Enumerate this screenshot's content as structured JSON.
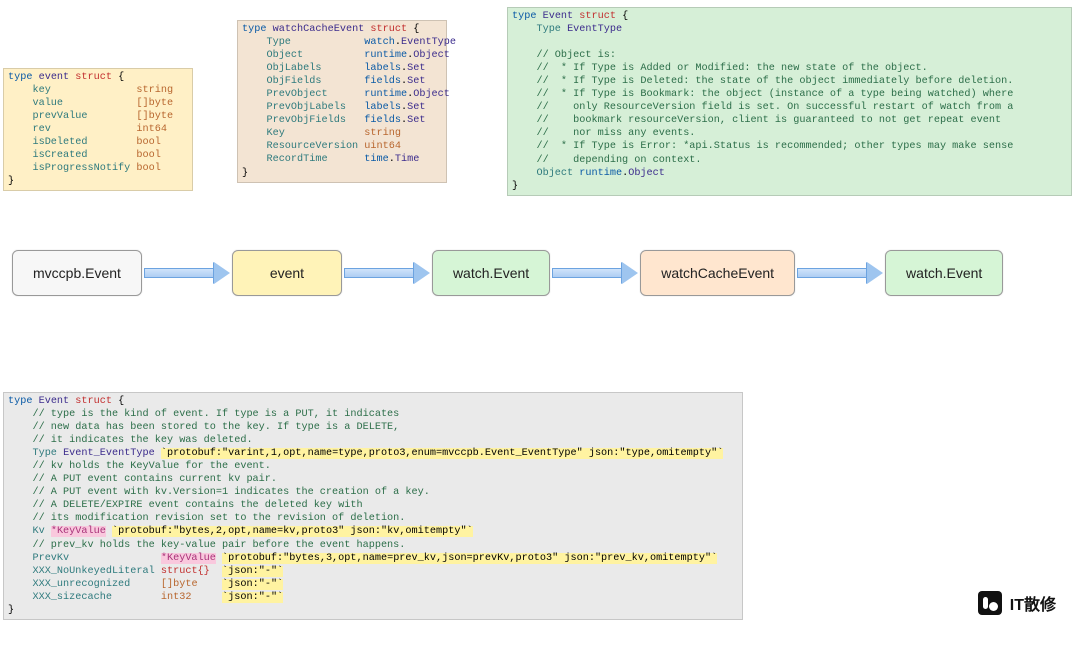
{
  "flow": {
    "nodes": [
      {
        "label": "mvccpb.Event",
        "cls": "node-white"
      },
      {
        "label": "event",
        "cls": "node-yellow"
      },
      {
        "label": "watch.Event",
        "cls": "node-green"
      },
      {
        "label": "watchCacheEvent",
        "cls": "node-peach"
      },
      {
        "label": "watch.Event",
        "cls": "node-green"
      }
    ]
  },
  "watermark": "IT散修",
  "event_struct": {
    "decl_type": "type",
    "name": "event",
    "kw_struct": "struct",
    "brace_open": "{",
    "brace_close": "}",
    "fields": [
      {
        "name": "key",
        "type": "string"
      },
      {
        "name": "value",
        "type": "[]byte"
      },
      {
        "name": "prevValue",
        "type": "[]byte"
      },
      {
        "name": "rev",
        "type": "int64"
      },
      {
        "name": "isDeleted",
        "type": "bool"
      },
      {
        "name": "isCreated",
        "type": "bool"
      },
      {
        "name": "isProgressNotify",
        "type": "bool"
      }
    ]
  },
  "wce_struct": {
    "decl_type": "type",
    "name": "watchCacheEvent",
    "kw_struct": "struct",
    "brace_open": "{",
    "brace_close": "}",
    "fields": [
      {
        "name": "Type",
        "pkg": "watch",
        "sub": "EventType"
      },
      {
        "name": "Object",
        "pkg": "runtime",
        "sub": "Object"
      },
      {
        "name": "ObjLabels",
        "pkg": "labels",
        "sub": "Set"
      },
      {
        "name": "ObjFields",
        "pkg": "fields",
        "sub": "Set"
      },
      {
        "name": "PrevObject",
        "pkg": "runtime",
        "sub": "Object"
      },
      {
        "name": "PrevObjLabels",
        "pkg": "labels",
        "sub": "Set"
      },
      {
        "name": "PrevObjFields",
        "pkg": "fields",
        "sub": "Set"
      },
      {
        "name": "Key",
        "pkg": "",
        "sub": "string"
      },
      {
        "name": "ResourceVersion",
        "pkg": "",
        "sub": "uint64"
      },
      {
        "name": "RecordTime",
        "pkg": "time",
        "sub": "Time"
      }
    ]
  },
  "watch_event": {
    "decl_type": "type",
    "name": "Event",
    "kw_struct": "struct",
    "brace_open": "{",
    "brace_close": "}",
    "type_field": "Type",
    "type_type": "EventType",
    "comments": [
      "// Object is:",
      "//  * If Type is Added or Modified: the new state of the object.",
      "//  * If Type is Deleted: the state of the object immediately before deletion.",
      "//  * If Type is Bookmark: the object (instance of a type being watched) where",
      "//    only ResourceVersion field is set. On successful restart of watch from a",
      "//    bookmark resourceVersion, client is guaranteed to not get repeat event",
      "//    nor miss any events.",
      "//  * If Type is Error: *api.Status is recommended; other types may make sense",
      "//    depending on context."
    ],
    "object_field": "Object",
    "object_pkg": "runtime",
    "object_sub": "Object"
  },
  "bottom_event": {
    "decl_type": "type",
    "name": "Event",
    "kw_struct": "struct",
    "brace_open": "{",
    "brace_close": "}",
    "c1": "// type is the kind of event. If type is a PUT, it indicates",
    "c2": "// new data has been stored to the key. If type is a DELETE,",
    "c3": "// it indicates the key was deleted.",
    "type_field": "Type",
    "type_type": "Event_EventType",
    "type_tag": "`protobuf:\"varint,1,opt,name=type,proto3,enum=mvccpb.Event_EventType\" json:\"type,omitempty\"`",
    "c4": "// kv holds the KeyValue for the event.",
    "c5": "// A PUT event contains current kv pair.",
    "c6": "// A PUT event with kv.Version=1 indicates the creation of a key.",
    "c7": "// A DELETE/EXPIRE event contains the deleted key with",
    "c8": "// its modification revision set to the revision of deletion.",
    "kv_field": "Kv",
    "kv_ptr": "*KeyValue",
    "kv_tag": "`protobuf:\"bytes,2,opt,name=kv,proto3\" json:\"kv,omitempty\"`",
    "c9": "// prev_kv holds the key-value pair before the event happens.",
    "prevkv_field": "PrevKv",
    "prevkv_ptr": "*KeyValue",
    "prevkv_tag": "`protobuf:\"bytes,3,opt,name=prev_kv,json=prevKv,proto3\" json:\"prev_kv,omitempty\"`",
    "xxx1_field": "XXX_NoUnkeyedLiteral",
    "xxx1_type": "struct{}",
    "xxx1_tag": "`json:\"-\"`",
    "xxx2_field": "XXX_unrecognized",
    "xxx2_type": "[]byte",
    "xxx2_tag": "`json:\"-\"`",
    "xxx3_field": "XXX_sizecache",
    "xxx3_type": "int32",
    "xxx3_tag": "`json:\"-\"`"
  }
}
